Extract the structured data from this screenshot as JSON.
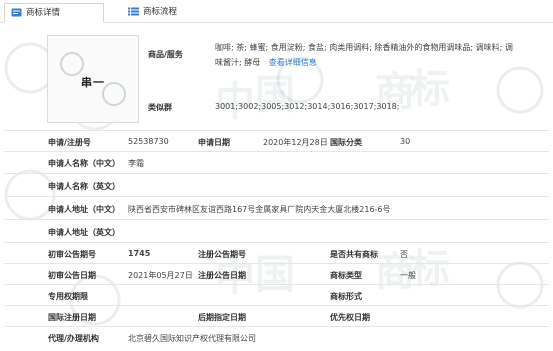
{
  "tabs": [
    {
      "label": "商标详情",
      "icon": "doc-icon"
    },
    {
      "label": "商标流程",
      "icon": "list-icon"
    }
  ],
  "trademark_image_text": "串一",
  "goods": {
    "label": "商品/服务",
    "value_line1": "咖啡; 茶; 蜂蜜; 食用淀粉; 食盐; 肉类用调料; 除香精油外的食物用调味品; 调味料; 调",
    "value_line2": "味酱汁; 酵母",
    "more_link": "查看详细信息"
  },
  "similar": {
    "label": "类似群",
    "value": "3001;3002;3005;3012;3014;3016;3017;3018;"
  },
  "app_number": {
    "label": "申请/注册号",
    "value": "52538730"
  },
  "app_date": {
    "label": "申请日期",
    "value": "2020年12月28日"
  },
  "intl_class": {
    "label": "国际分类",
    "value": "30"
  },
  "applicant_cn": {
    "label": "申请人名称（中文）",
    "value": "李霜"
  },
  "applicant_en": {
    "label": "申请人名称（英文）",
    "value": ""
  },
  "address_cn": {
    "label": "申请人地址（中文）",
    "value": "陕西省西安市碑林区友谊西路167号金属家具厂院内天金大厦北楼216-6号"
  },
  "address_en": {
    "label": "申请人地址（英文）",
    "value": ""
  },
  "prelim_issue": {
    "label": "初审公告期号",
    "value": "1745"
  },
  "reg_issue": {
    "label": "注册公告期号",
    "value": ""
  },
  "shared": {
    "label": "是否共有商标",
    "value": "否"
  },
  "prelim_date": {
    "label": "初审公告日期",
    "value": "2021年05月27日"
  },
  "reg_date": {
    "label": "注册公告日期",
    "value": ""
  },
  "tm_type": {
    "label": "商标类型",
    "value": "一般"
  },
  "exclusive": {
    "label": "专用权期限",
    "value": ""
  },
  "tm_form": {
    "label": "商标形式",
    "value": ""
  },
  "intl_reg_date": {
    "label": "国际注册日期",
    "value": ""
  },
  "later_date": {
    "label": "后期指定日期",
    "value": ""
  },
  "priority_date": {
    "label": "优先权日期",
    "value": ""
  },
  "agent": {
    "label": "代理/办理机构",
    "value": "北京碧久国际知识产权代理有限公司"
  },
  "colors": {
    "link": "#2a7ad3",
    "border": "#e6e6e6",
    "watermark": "#789aa0"
  }
}
